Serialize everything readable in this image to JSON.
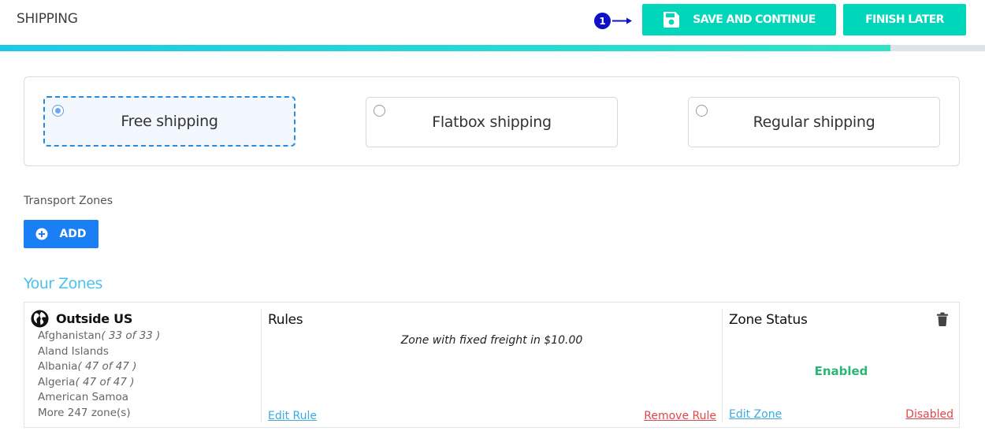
{
  "header": {
    "title": "SHIPPING",
    "step_number": "1",
    "save_label": "SAVE AND CONTINUE",
    "finish_label": "FINISH LATER",
    "accent_color": "#00d6b9"
  },
  "progress": {
    "percent": 90.4
  },
  "shipping_options": [
    {
      "label": "Free shipping",
      "selected": true
    },
    {
      "label": "Flatbox shipping",
      "selected": false
    },
    {
      "label": "Regular shipping",
      "selected": false
    }
  ],
  "transport_zones": {
    "label": "Transport Zones",
    "add_label": "ADD",
    "add_color": "#1a7ef5"
  },
  "your_zones": {
    "heading": "Your Zones",
    "zone": {
      "name": "Outside US",
      "icon": "globe-icon",
      "countries": [
        {
          "name": "Afghanistan",
          "count": "( 33 of 33 )"
        },
        {
          "name": "Aland Islands",
          "count": ""
        },
        {
          "name": "Albania",
          "count": "( 47 of 47 )"
        },
        {
          "name": "Algeria",
          "count": "( 47 of 47 )"
        },
        {
          "name": "American Samoa",
          "count": ""
        }
      ],
      "more": "More 247 zone(s)",
      "rules_title": "Rules",
      "rule_description": "Zone with fixed freight in $10.00",
      "edit_rule": "Edit Rule",
      "remove_rule": "Remove Rule",
      "status_title": "Zone Status",
      "status_value": "Enabled",
      "edit_zone": "Edit Zone",
      "disable_link": "Disabled"
    }
  }
}
